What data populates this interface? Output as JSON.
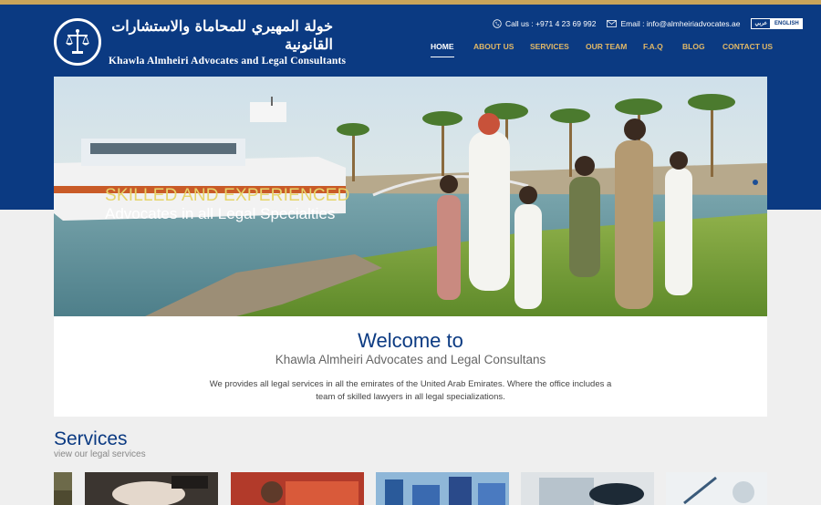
{
  "header": {
    "logo_ar": "خولة المهيري للمحاماة والاستشارات القانونية",
    "logo_en": "Khawla Almheiri Advocates and Legal Consultants",
    "call": "Call us : +971 4 23 69 992",
    "email": "Email : info@almheiriadvocates.ae",
    "lang_ar": "عربي",
    "lang_en": "ENGLISH"
  },
  "nav": [
    {
      "label": "HOME",
      "active": true
    },
    {
      "label": "ABOUT US",
      "active": false
    },
    {
      "label": "SERVICES",
      "active": false
    },
    {
      "label": "OUR TEAM",
      "active": false
    },
    {
      "label": "F.A.Q",
      "active": false
    },
    {
      "label": "BLOG",
      "active": false
    },
    {
      "label": "CONTACT US",
      "active": false
    }
  ],
  "hero": {
    "headline": "SKILLED AND EXPERIENCED",
    "subline": "Advocates in all Legal Specialties"
  },
  "welcome": {
    "title": "Welcome to",
    "subtitle": "Khawla Almheiri Advocates and Legal Consultans",
    "text": "We provides all legal services in all the emirates of the United Arab Emirates. Where the office includes a team of skilled lawyers in all legal specializations."
  },
  "services": {
    "title": "Services",
    "subtitle": "view our legal services"
  },
  "colors": {
    "brand_blue": "#0b3a82",
    "gold": "#e1b867"
  }
}
